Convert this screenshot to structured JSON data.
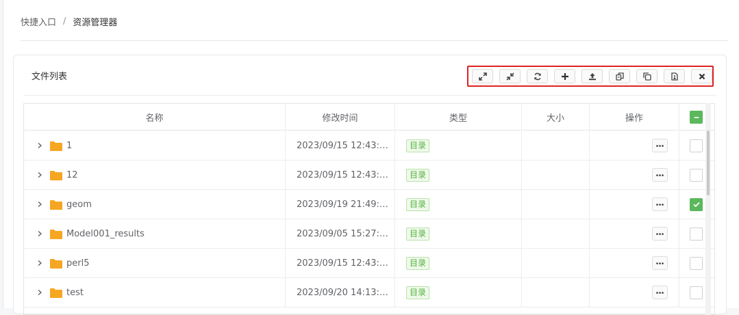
{
  "breadcrumb": {
    "root": "快捷入口",
    "separator": "/",
    "current": "资源管理器"
  },
  "card": {
    "title": "文件列表"
  },
  "toolbar": {
    "buttons": [
      {
        "name": "expand-icon"
      },
      {
        "name": "collapse-icon"
      },
      {
        "name": "refresh-icon"
      },
      {
        "name": "add-icon"
      },
      {
        "name": "upload-icon"
      },
      {
        "name": "copy-icon"
      },
      {
        "name": "duplicate-icon"
      },
      {
        "name": "zip-file-icon"
      },
      {
        "name": "close-icon"
      }
    ]
  },
  "table": {
    "columns": {
      "name": "名称",
      "time": "修改时间",
      "type": "类型",
      "size": "大小",
      "ops": "操作"
    },
    "rows": [
      {
        "name": "1",
        "time": "2023/09/15 12:43:…",
        "type": "目录",
        "size": "",
        "checked": false
      },
      {
        "name": "12",
        "time": "2023/09/15 12:43:…",
        "type": "目录",
        "size": "",
        "checked": false
      },
      {
        "name": "geom",
        "time": "2023/09/19 21:49:…",
        "type": "目录",
        "size": "",
        "checked": true
      },
      {
        "name": "Model001_results",
        "time": "2023/09/05 15:27:…",
        "type": "目录",
        "size": "",
        "checked": false
      },
      {
        "name": "perl5",
        "time": "2023/09/15 12:43:…",
        "type": "目录",
        "size": "",
        "checked": false
      },
      {
        "name": "test",
        "time": "2023/09/20 14:13:…",
        "type": "目录",
        "size": "",
        "checked": false
      }
    ]
  },
  "colors": {
    "accent_green": "#5cb85c",
    "folder": "#f5a623",
    "highlight_border": "#e02020"
  }
}
